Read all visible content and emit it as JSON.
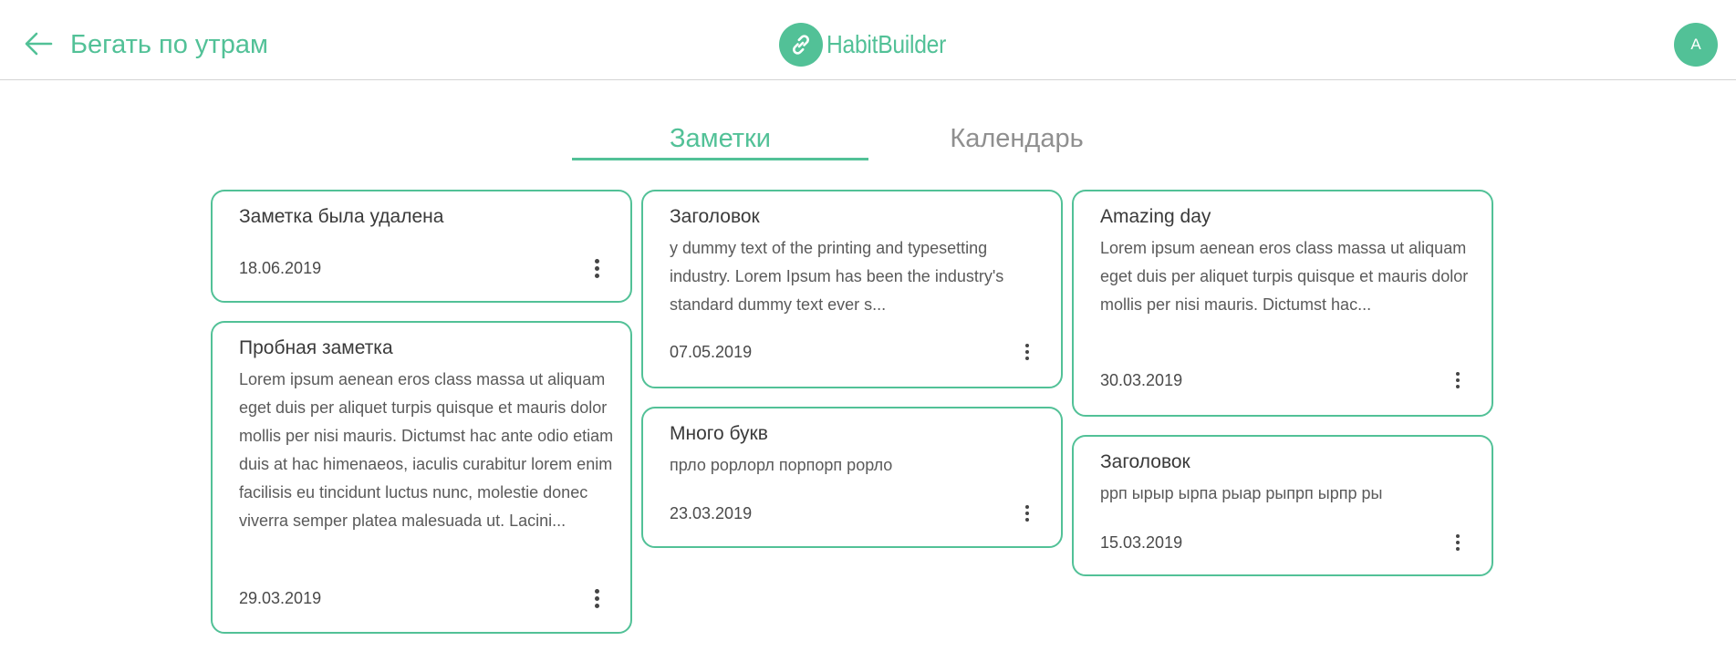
{
  "header": {
    "page_title": "Бегать по утрам",
    "brand": "HabitBuilder",
    "avatar_letter": "A"
  },
  "tabs": [
    {
      "label": "Заметки",
      "active": true
    },
    {
      "label": "Календарь",
      "active": false
    }
  ],
  "notes": [
    {
      "title": "Заметка была удалена",
      "text": "",
      "date": "18.06.2019"
    },
    {
      "title": "Пробная заметка",
      "text": "Lorem ipsum aenean eros class massa ut aliquam eget duis per aliquet turpis quisque et mauris dolor mollis per nisi mauris. Dictumst hac ante odio etiam duis at hac himenaeos, iaculis curabitur lorem enim facilisis eu tincidunt luctus nunc, molestie donec viverra semper platea malesuada ut. Lacini...",
      "date": "29.03.2019"
    },
    {
      "title": "Заголовок",
      "text": "y dummy text of the printing and typesetting industry. Lorem Ipsum has been the industry's standard dummy text ever s...",
      "date": "07.05.2019"
    },
    {
      "title": "Много букв",
      "text": "прло рорлорл порпорп рорло",
      "date": "23.03.2019"
    },
    {
      "title": "Amazing day",
      "text": "Lorem ipsum aenean eros class massa ut aliquam eget duis per aliquet turpis quisque et mauris dolor mollis per nisi mauris. Dictumst hac...",
      "date": "30.03.2019"
    },
    {
      "title": "Заголовок",
      "text": "ррп ырыр ырпа рыар рыпрп ырпр ры",
      "date": "15.03.2019"
    }
  ],
  "colors": {
    "accent": "#52c197",
    "divider": "#d4d4d4",
    "tab_inactive": "#8f8f8f"
  },
  "icons": {
    "back": "arrow-left-icon",
    "logo": "link-icon",
    "card_menu": "more-vertical-icon"
  }
}
